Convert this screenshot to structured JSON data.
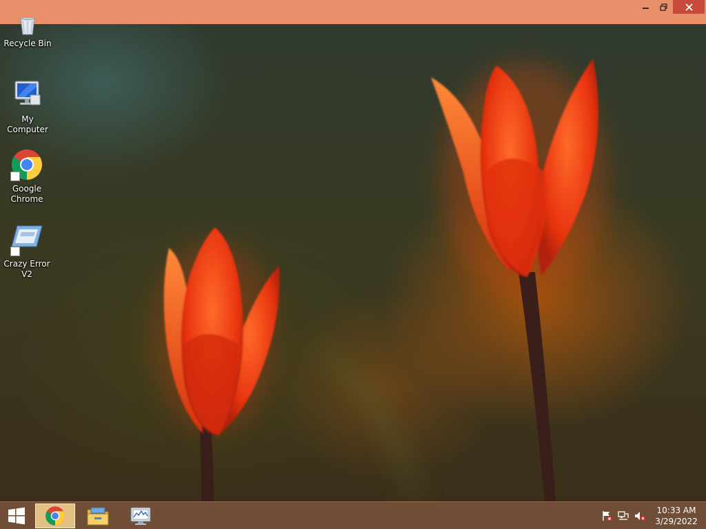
{
  "window": {
    "controls": {
      "minimize_icon": "minimize-icon",
      "maximize_icon": "restore-icon",
      "close_icon": "close-icon"
    },
    "titlebar_color": "#e9906a",
    "close_color": "#c74a3a"
  },
  "desktop": {
    "icons": [
      {
        "label": "Recycle Bin",
        "icon": "recycle-bin-icon"
      },
      {
        "label": "My Computer",
        "icon": "computer-icon"
      },
      {
        "label": "Google Chrome",
        "icon": "chrome-icon"
      },
      {
        "label": "Crazy Error V2",
        "icon": "app-window-icon"
      }
    ],
    "wallpaper": "red-tulips"
  },
  "taskbar": {
    "start_icon": "windows-logo-icon",
    "pinned": [
      {
        "name": "chrome",
        "icon": "chrome-icon",
        "active": true
      },
      {
        "name": "file-explorer",
        "icon": "folder-icon",
        "active": false
      },
      {
        "name": "performance-monitor",
        "icon": "perfmon-icon",
        "active": false
      }
    ],
    "tray": {
      "icons": [
        "action-center-flag-icon",
        "network-icon",
        "volume-muted-icon"
      ]
    },
    "clock": {
      "time": "10:33 AM",
      "date": "3/29/2022"
    }
  }
}
